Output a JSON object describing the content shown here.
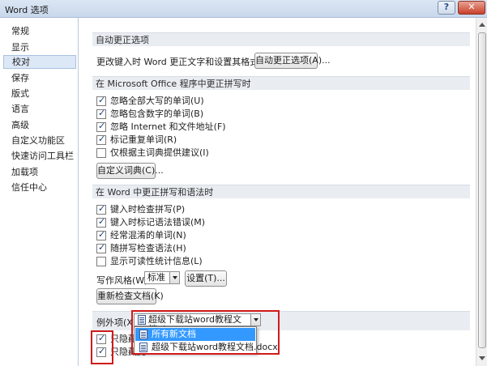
{
  "window": {
    "title": "Word 选项",
    "help_label": "?",
    "close_label": "✕"
  },
  "nav": {
    "items": [
      {
        "label": "常规",
        "selected": false
      },
      {
        "label": "显示",
        "selected": false
      },
      {
        "label": "校对",
        "selected": true
      },
      {
        "label": "保存",
        "selected": false
      },
      {
        "label": "版式",
        "selected": false
      },
      {
        "label": "语言",
        "selected": false
      },
      {
        "label": "高级",
        "selected": false
      },
      {
        "label": "自定义功能区",
        "selected": false
      },
      {
        "label": "快速访问工具栏",
        "selected": false
      },
      {
        "label": "加载项",
        "selected": false
      },
      {
        "label": "信任中心",
        "selected": false
      }
    ]
  },
  "autocorrect": {
    "header": "自动更正选项",
    "description": "更改键入时 Word 更正文字和设置其格式的方式:",
    "button_label": "自动更正选项(A)..."
  },
  "office_spelling": {
    "header": "在 Microsoft Office 程序中更正拼写时",
    "options": [
      {
        "label": "忽略全部大写的单词(U)",
        "checked": true
      },
      {
        "label": "忽略包含数字的单词(B)",
        "checked": true
      },
      {
        "label": "忽略 Internet 和文件地址(F)",
        "checked": true
      },
      {
        "label": "标记重复单词(R)",
        "checked": true
      },
      {
        "label": "仅根据主词典提供建议(I)",
        "checked": false
      }
    ],
    "dictionary_button": "自定义词典(C)..."
  },
  "word_spelling": {
    "header": "在 Word 中更正拼写和语法时",
    "options": [
      {
        "label": "键入时检查拼写(P)",
        "checked": true
      },
      {
        "label": "键入时标记语法错误(M)",
        "checked": true
      },
      {
        "label": "经常混淆的单词(N)",
        "checked": true
      },
      {
        "label": "随拼写检查语法(H)",
        "checked": true
      },
      {
        "label": "显示可读性统计信息(L)",
        "checked": false
      }
    ],
    "style_label": "写作风格(W):",
    "style_value": "标准",
    "settings_button": "设置(T)...",
    "recheck_button": "重新检查文档(K)"
  },
  "exceptions": {
    "label": "例外项(X):",
    "selected_doc": "超级下载站word教程文档.docx",
    "options": [
      {
        "label": "所有新文档",
        "highlighted": true
      },
      {
        "label": "超级下载站word教程文档.docx",
        "highlighted": false
      }
    ],
    "hidden_checks": [
      {
        "label": "只隐藏此",
        "checked": true
      },
      {
        "label": "只隐藏此",
        "checked": true
      }
    ]
  },
  "annotation_color": "#d11a1a"
}
